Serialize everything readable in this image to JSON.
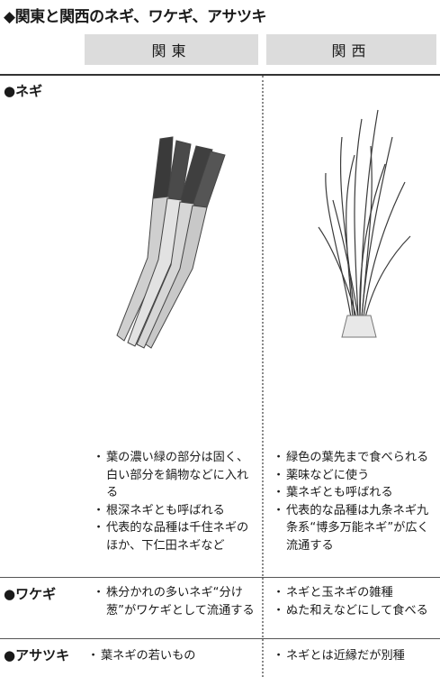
{
  "title": "◆関東と関西のネギ、ワケギ、アサツキ",
  "columns": {
    "kanto": "関東",
    "kansai": "関西"
  },
  "rows": {
    "negi": {
      "label": "●ネギ",
      "kanto": [
        "葉の濃い緑の部分は固く、白い部分を鍋物などに入れる",
        "根深ネギとも呼ばれる",
        "代表的な品種は千住ネギのほか、下仁田ネギなど"
      ],
      "kansai": [
        "緑色の葉先まで食べられる",
        "薬味などに使う",
        "葉ネギとも呼ばれる",
        "代表的な品種は九条ネギ九条系“博多万能ネギ”が広く流通する"
      ]
    },
    "wakegi": {
      "label": "●ワケギ",
      "kanto": [
        "株分かれの多いネギ“分け葱”がワケギとして流通する"
      ],
      "kansai": [
        "ネギと玉ネギの雑種",
        "ぬた和えなどにして食べる"
      ]
    },
    "asatsuki": {
      "label": "●アサツキ",
      "kanto": [
        "葉ネギの若いもの"
      ],
      "kansai": [
        "ネギとは近縁だが別種"
      ]
    }
  }
}
